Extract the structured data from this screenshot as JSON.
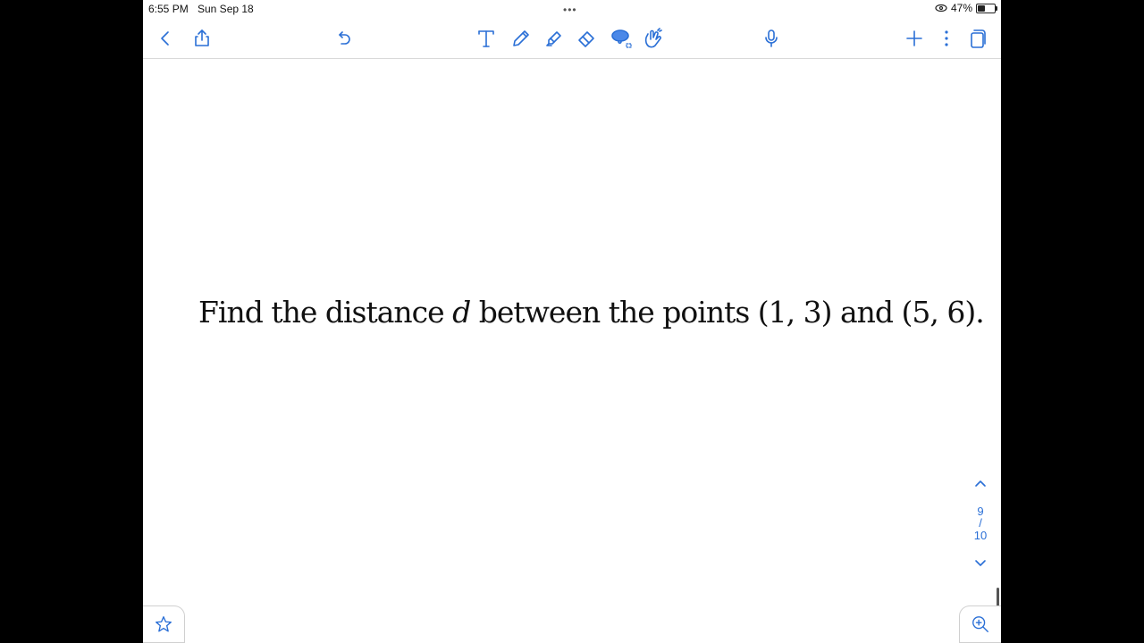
{
  "status_bar": {
    "time": "6:55 PM",
    "date": "Sun Sep 18",
    "battery": "47%",
    "battery_level": 0.47
  },
  "toolbar": {
    "icons": [
      "back-chevron-icon",
      "share-icon",
      "undo-icon",
      "text-tool-icon",
      "pen-icon",
      "highlighter-icon",
      "eraser-icon",
      "lasso-icon",
      "gesture-icon",
      "microphone-icon",
      "add-icon",
      "more-icon",
      "pages-icon"
    ]
  },
  "document": {
    "text_prefix": "Find the distance ",
    "text_variable": "d",
    "text_suffix": " between the points (1, 3) and (5, 6)."
  },
  "page_indicator": {
    "current": "9",
    "separator": "/",
    "total": "10"
  },
  "accent_color": "#2a6fd6"
}
